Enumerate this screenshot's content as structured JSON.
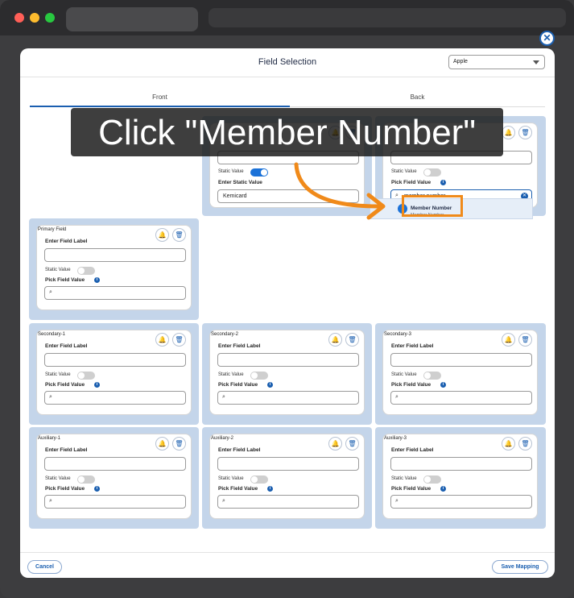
{
  "modal": {
    "title": "Field Selection",
    "platform_select": "Apple",
    "close": "✕"
  },
  "tabs": {
    "front": "Front",
    "back": "Back"
  },
  "labels": {
    "enter_field_label": "Enter Field Label",
    "enter_static_value": "Enter Static Value",
    "static_value": "Static Value",
    "pick_field_value": "Pick Field Value"
  },
  "cards": {
    "header_mid": {
      "static_value": "Kemicard"
    },
    "header_right": {
      "search": "member number"
    },
    "primary": {
      "title": "Primary Field"
    },
    "secondary_1": {
      "title": "Secondary-1"
    },
    "secondary_2": {
      "title": "Secondary-2"
    },
    "secondary_3": {
      "title": "Secondary-3"
    },
    "auxiliary_1": {
      "title": "Auxiliary-1"
    },
    "auxiliary_2": {
      "title": "Auxiliary-2"
    },
    "auxiliary_3": {
      "title": "Auxiliary-3"
    }
  },
  "dropdown": {
    "option": "Member Number",
    "sub": "Member Number"
  },
  "overlay": {
    "text": "Click \"Member Number\""
  },
  "footer": {
    "cancel": "Cancel",
    "save": "Save Mapping"
  },
  "icons": {
    "bell": "bell-icon",
    "trash": "trash-icon",
    "search": "search-icon",
    "info": "info-icon"
  },
  "colors": {
    "accent": "#1b5fb0",
    "panel": "#c4d5ea",
    "highlight": "#f08a1a"
  }
}
